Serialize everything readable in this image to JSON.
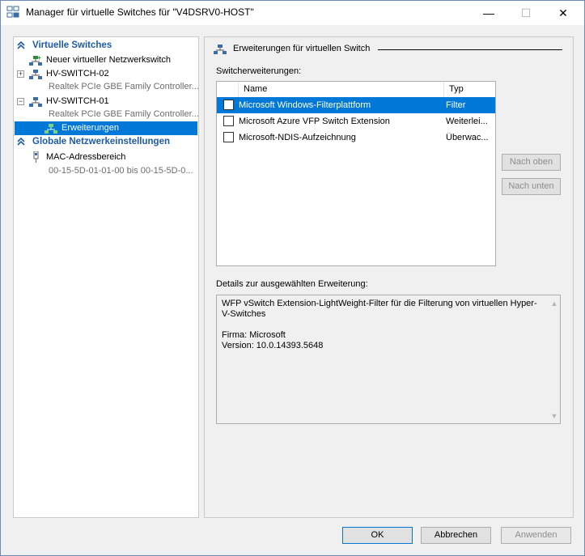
{
  "window": {
    "title": "Manager für virtuelle Switches für \"V4DSRV0-HOST\"",
    "controls": {
      "minimize": "—",
      "maximize": "☐",
      "close": "✕"
    }
  },
  "left": {
    "section1": "Virtuelle Switches",
    "new_switch": "Neuer virtueller Netzwerkswitch",
    "switch2": {
      "name": "HV-SWITCH-02",
      "adapter": "Realtek PCIe GBE Family Controller...",
      "expander": "+"
    },
    "switch1": {
      "name": "HV-SWITCH-01",
      "adapter": "Realtek PCIe GBE Family Controller...",
      "expander": "−"
    },
    "extensions": "Erweiterungen",
    "section2": "Globale Netzwerkeinstellungen",
    "mac_range": "MAC-Adressbereich",
    "mac_value": "00-15-5D-01-01-00 bis 00-15-5D-0..."
  },
  "right": {
    "group_title": "Erweiterungen für virtuellen Switch",
    "list_label": "Switcherweiterungen:",
    "columns": {
      "name": "Name",
      "type": "Typ"
    },
    "rows": [
      {
        "name": "Microsoft Windows-Filterplattform",
        "type": "Filter"
      },
      {
        "name": "Microsoft Azure VFP Switch Extension",
        "type": "Weiterlei..."
      },
      {
        "name": "Microsoft-NDIS-Aufzeichnung",
        "type": "Überwac..."
      }
    ],
    "move_up": "Nach oben",
    "move_down": "Nach unten",
    "details_label": "Details zur ausgewählten Erweiterung:",
    "details": {
      "line1": "WFP vSwitch Extension-LightWeight-Filter für die Filterung von virtuellen Hyper-",
      "line2": "V-Switches",
      "company": "Firma: Microsoft",
      "version": "Version: 10.0.14393.5648"
    }
  },
  "footer": {
    "ok": "OK",
    "cancel": "Abbrechen",
    "apply": "Anwenden"
  },
  "colors": {
    "accent": "#0078d7",
    "section_head": "#1e5aa8"
  }
}
